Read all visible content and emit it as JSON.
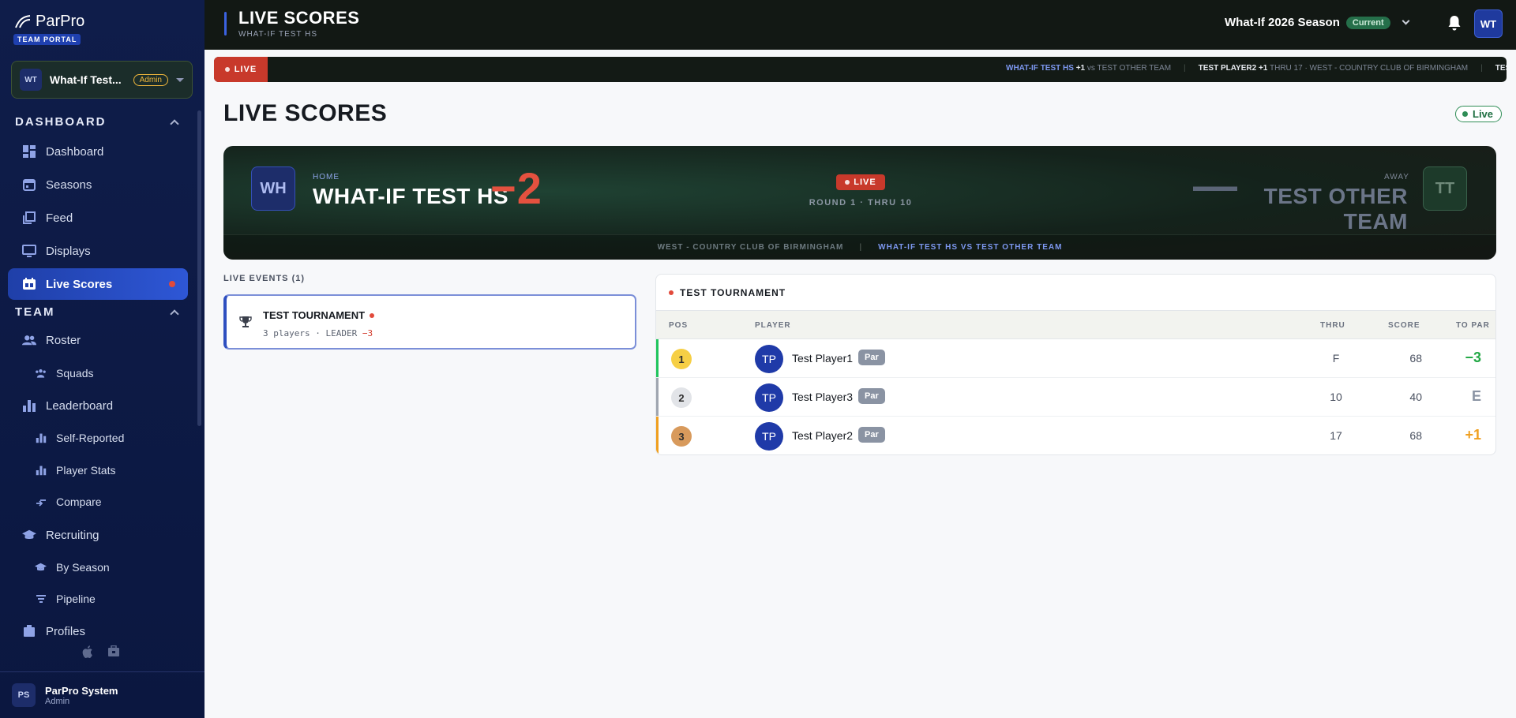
{
  "sidebar": {
    "brand": "ParPro",
    "portal": "TEAM PORTAL",
    "team": {
      "initials": "WT",
      "name": "What-If Test...",
      "role": "Admin"
    },
    "sections": {
      "dashboard": "DASHBOARD",
      "team": "TEAM"
    },
    "items": {
      "dashboard": "Dashboard",
      "seasons": "Seasons",
      "feed": "Feed",
      "displays": "Displays",
      "live_scores": "Live Scores",
      "roster": "Roster",
      "squads": "Squads",
      "leaderboard": "Leaderboard",
      "self_reported": "Self-Reported",
      "player_stats": "Player Stats",
      "compare": "Compare",
      "recruiting": "Recruiting",
      "by_season": "By Season",
      "pipeline": "Pipeline",
      "profiles": "Profiles"
    },
    "user": {
      "initials": "PS",
      "name": "ParPro System",
      "role": "Admin"
    }
  },
  "topbar": {
    "title": "LIVE SCORES",
    "subtitle": "WHAT-IF TEST HS",
    "season": "What-If 2026 Season",
    "season_badge": "Current",
    "avatar": "WT"
  },
  "ticker": {
    "live_label": "LIVE",
    "item1_team": "WHAT-IF TEST HS",
    "item1_score": "+1",
    "item1_rest": "vs TEST OTHER TEAM",
    "item2_player": "TEST PLAYER2",
    "item2_score": "+1",
    "item2_rest": "THRU 17 · WEST - COUNTRY CLUB OF BIRMINGHAM",
    "item3": "TEST PLA"
  },
  "page": {
    "title": "LIVE SCORES",
    "status": "Live"
  },
  "match": {
    "home_initials": "WH",
    "home_label": "HOME",
    "home_name": "WHAT-IF TEST HS",
    "home_score": "−2",
    "live": "LIVE",
    "round": "ROUND 1 · THRU 10",
    "away_score": "—",
    "away_label": "AWAY",
    "away_name": "TEST OTHER TEAM",
    "away_initials": "TT",
    "venue": "WEST - COUNTRY CLUB OF BIRMINGHAM",
    "versus": "WHAT-IF TEST HS VS TEST OTHER TEAM"
  },
  "live_events": {
    "heading": "LIVE EVENTS (1)",
    "event_name": "TEST TOURNAMENT",
    "event_meta": "3 players · LEADER",
    "event_leader": "−3"
  },
  "leaderboard": {
    "title": "TEST TOURNAMENT",
    "columns": {
      "pos": "POS",
      "player": "PLAYER",
      "thru": "THRU",
      "score": "SCORE",
      "topar": "TO PAR"
    },
    "rows": [
      {
        "pos": "1",
        "initials": "TP",
        "name": "Test Player1",
        "badge": "Par",
        "thru": "F",
        "score": "68",
        "topar": "−3",
        "color": "#22a845"
      },
      {
        "pos": "2",
        "initials": "TP",
        "name": "Test Player3",
        "badge": "Par",
        "thru": "10",
        "score": "40",
        "topar": "E",
        "color": "#8a93a3"
      },
      {
        "pos": "3",
        "initials": "TP",
        "name": "Test Player2",
        "badge": "Par",
        "thru": "17",
        "score": "68",
        "topar": "+1",
        "color": "#f0a020"
      }
    ]
  }
}
